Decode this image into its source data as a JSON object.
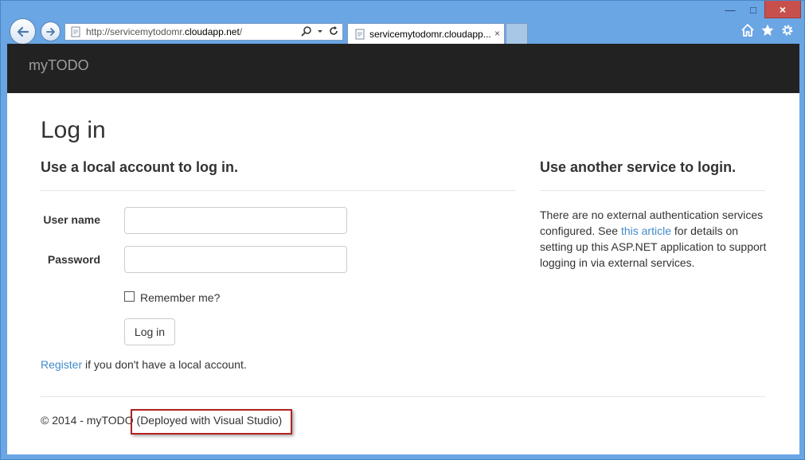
{
  "browser": {
    "address": {
      "prefix": "http://servicemytodomr.",
      "host": "cloudapp.net",
      "suffix": "/"
    },
    "tab": {
      "title": "servicemytodomr.cloudapp...",
      "close": "×"
    },
    "window_controls": {
      "minimize": "—",
      "maximize": "□",
      "close": "×"
    },
    "icons": [
      "back-arrow-icon",
      "forward-arrow-icon",
      "page-icon",
      "search-icon",
      "dropdown-icon",
      "refresh-icon",
      "home-icon",
      "favorites-star-icon",
      "gear-icon"
    ]
  },
  "site": {
    "brand": "myTODO"
  },
  "login": {
    "title": "Log in",
    "local_heading": "Use a local account to log in.",
    "username_label": "User name",
    "password_label": "Password",
    "remember_label": "Remember me?",
    "submit_label": "Log in",
    "register_link": "Register",
    "register_text": " if you don't have a local account."
  },
  "external": {
    "heading": "Use another service to login.",
    "text_before": "There are no external authentication services configured. See ",
    "link": "this article",
    "text_after": " for details on setting up this ASP.NET application to support logging in via external services."
  },
  "footer": {
    "text": "© 2014 - myTODO (Deployed with Visual Studio)"
  },
  "colors": {
    "navbar": "#222222",
    "brand": "#9d9d9d",
    "link": "#428bca",
    "highlight_border": "#b22222",
    "window_frame": "#6aa5e4"
  }
}
